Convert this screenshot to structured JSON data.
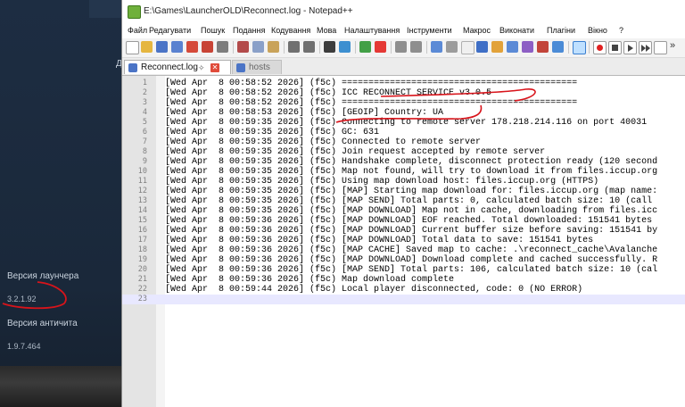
{
  "launcher": {
    "fragment": "Д",
    "launcher_version_label": "Версия лаунчера",
    "launcher_version_value": "3.2.1.92",
    "anticheat_version_label": "Версия античита",
    "anticheat_version_value": "1.9.7.464"
  },
  "window": {
    "title": "E:\\Games\\LauncherOLD\\Reconnect.log - Notepad++"
  },
  "menu": [
    "Файл",
    "Редагувати",
    "Пошук",
    "Подання",
    "Кодування",
    "Мова",
    "Налаштування",
    "Інструменти",
    "Макрос",
    "Виконати",
    "Плагіни",
    "Вікно",
    "?"
  ],
  "tabs": [
    {
      "label": "Reconnect.log"
    },
    {
      "label": "hosts"
    }
  ],
  "editor": {
    "lines": [
      {
        "n": "1",
        "text": "[Wed Apr  8 00:58:52 2026] (f5c) ============================================"
      },
      {
        "n": "2",
        "text": "[Wed Apr  8 00:58:52 2026] (f5c) ICC RECONNECT SERVICE v3.0.5"
      },
      {
        "n": "3",
        "text": "[Wed Apr  8 00:58:52 2026] (f5c) ============================================"
      },
      {
        "n": "4",
        "text": "[Wed Apr  8 00:58:53 2026] (f5c) [GEOIP] Country: UA"
      },
      {
        "n": "5",
        "text": "[Wed Apr  8 00:59:35 2026] (f5c) Connecting to remote server 178.218.214.116 on port 40031"
      },
      {
        "n": "6",
        "text": "[Wed Apr  8 00:59:35 2026] (f5c) GC: 631"
      },
      {
        "n": "7",
        "text": "[Wed Apr  8 00:59:35 2026] (f5c) Connected to remote server"
      },
      {
        "n": "8",
        "text": "[Wed Apr  8 00:59:35 2026] (f5c) Join request accepted by remote server"
      },
      {
        "n": "9",
        "text": "[Wed Apr  8 00:59:35 2026] (f5c) Handshake complete, disconnect protection ready (120 second"
      },
      {
        "n": "10",
        "text": "[Wed Apr  8 00:59:35 2026] (f5c) Map not found, will try to download it from files.iccup.org"
      },
      {
        "n": "11",
        "text": "[Wed Apr  8 00:59:35 2026] (f5c) Using map download host: files.iccup.org (HTTPS)"
      },
      {
        "n": "12",
        "text": "[Wed Apr  8 00:59:35 2026] (f5c) [MAP] Starting map download for: files.iccup.org (map name:"
      },
      {
        "n": "13",
        "text": "[Wed Apr  8 00:59:35 2026] (f5c) [MAP SEND] Total parts: 0, calculated batch size: 10 (call"
      },
      {
        "n": "14",
        "text": "[Wed Apr  8 00:59:35 2026] (f5c) [MAP DOWNLOAD] Map not in cache, downloading from files.icc"
      },
      {
        "n": "15",
        "text": "[Wed Apr  8 00:59:36 2026] (f5c) [MAP DOWNLOAD] EOF reached. Total downloaded: 151541 bytes"
      },
      {
        "n": "16",
        "text": "[Wed Apr  8 00:59:36 2026] (f5c) [MAP DOWNLOAD] Current buffer size before saving: 151541 by"
      },
      {
        "n": "17",
        "text": "[Wed Apr  8 00:59:36 2026] (f5c) [MAP DOWNLOAD] Total data to save: 151541 bytes"
      },
      {
        "n": "18",
        "text": "[Wed Apr  8 00:59:36 2026] (f5c) [MAP CACHE] Saved map to cache: .\\reconnect_cache\\Avalanche"
      },
      {
        "n": "19",
        "text": "[Wed Apr  8 00:59:36 2026] (f5c) [MAP DOWNLOAD] Download complete and cached successfully. R"
      },
      {
        "n": "20",
        "text": "[Wed Apr  8 00:59:36 2026] (f5c) [MAP SEND] Total parts: 106, calculated batch size: 10 (cal"
      },
      {
        "n": "21",
        "text": "[Wed Apr  8 00:59:36 2026] (f5c) Map download complete"
      },
      {
        "n": "22",
        "text": "[Wed Apr  8 00:59:44 2026] (f5c) Local player disconnected, code: 0 (NO ERROR)"
      },
      {
        "n": "23",
        "text": ""
      }
    ]
  },
  "colors": {
    "annotation": "#d8141b",
    "current_line": "#e8e8ff"
  }
}
